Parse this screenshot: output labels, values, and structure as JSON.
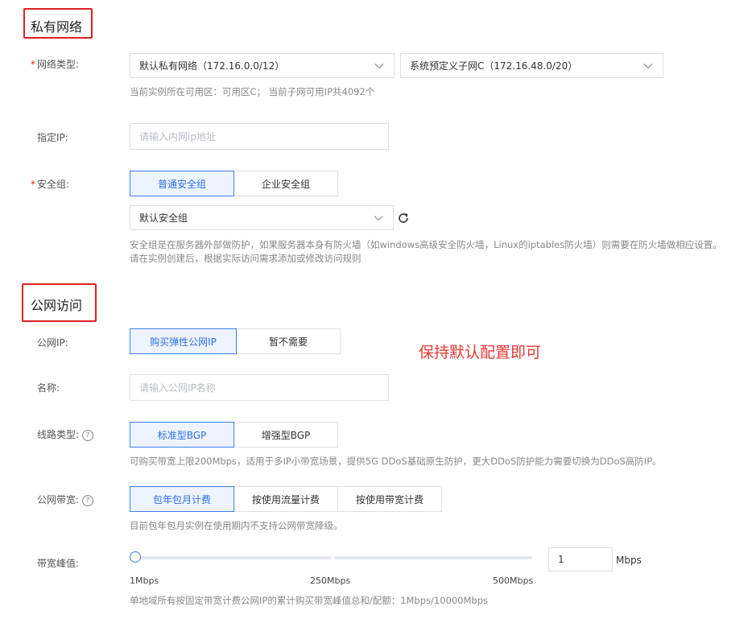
{
  "private_network": {
    "title": "私有网络",
    "network_type": {
      "label": "网络类型:",
      "vpc_value": "默认私有网络（172.16.0.0/12）",
      "subnet_value": "系统预定义子网C（172.16.48.0/20）",
      "hint": "当前实例所在可用区：可用区C； 当前子网可用IP共4092个"
    },
    "ip": {
      "label": "指定IP:",
      "placeholder": "请输入内网ip地址"
    },
    "security_group": {
      "label": "安全组:",
      "options": [
        "普通安全组",
        "企业安全组"
      ],
      "selected": "默认安全组",
      "hint_line1": "安全组是在服务器外部做防护，如果服务器本身有防火墙（如windows高级安全防火墙，Linux的iptables防火墙）则需要在防火墙做相应设置。",
      "hint_line2": "请在实例创建后，根据实际访问需求添加或修改访问规则"
    }
  },
  "public_access": {
    "title": "公网访问",
    "public_ip": {
      "label": "公网IP:",
      "options": [
        "购买弹性公网IP",
        "暂不需要"
      ]
    },
    "annotation": "保持默认配置即可",
    "name": {
      "label": "名称:",
      "placeholder": "请输入公网IP名称"
    },
    "line_type": {
      "label": "线路类型:",
      "options": [
        "标准型BGP",
        "增强型BGP"
      ],
      "hint": "可购买带宽上限200Mbps，适用于多IP小带宽场景，提供5G DDoS基础原生防护，更大DDoS防护能力需要切换为DDoS高防IP。"
    },
    "billing": {
      "label": "公网带宽:",
      "options": [
        "包年包月计费",
        "按使用流量计费",
        "按使用带宽计费"
      ],
      "hint": "目前包年包月实例在使用期内不支持公网带宽降级。"
    },
    "bandwidth": {
      "label": "带宽峰值:",
      "value": "1",
      "unit": "Mbps",
      "ticks": [
        "1Mbps",
        "250Mbps",
        "500Mbps"
      ],
      "slider_fraction": 0,
      "hint": "单地域所有按固定带宽计费公网IP的累计购买带宽峰值总和/配额：1Mbps/10000Mbps"
    }
  },
  "colors": {
    "accent": "#3d7df2",
    "annotation": "#e53935",
    "highlight_box": "#e02020"
  }
}
